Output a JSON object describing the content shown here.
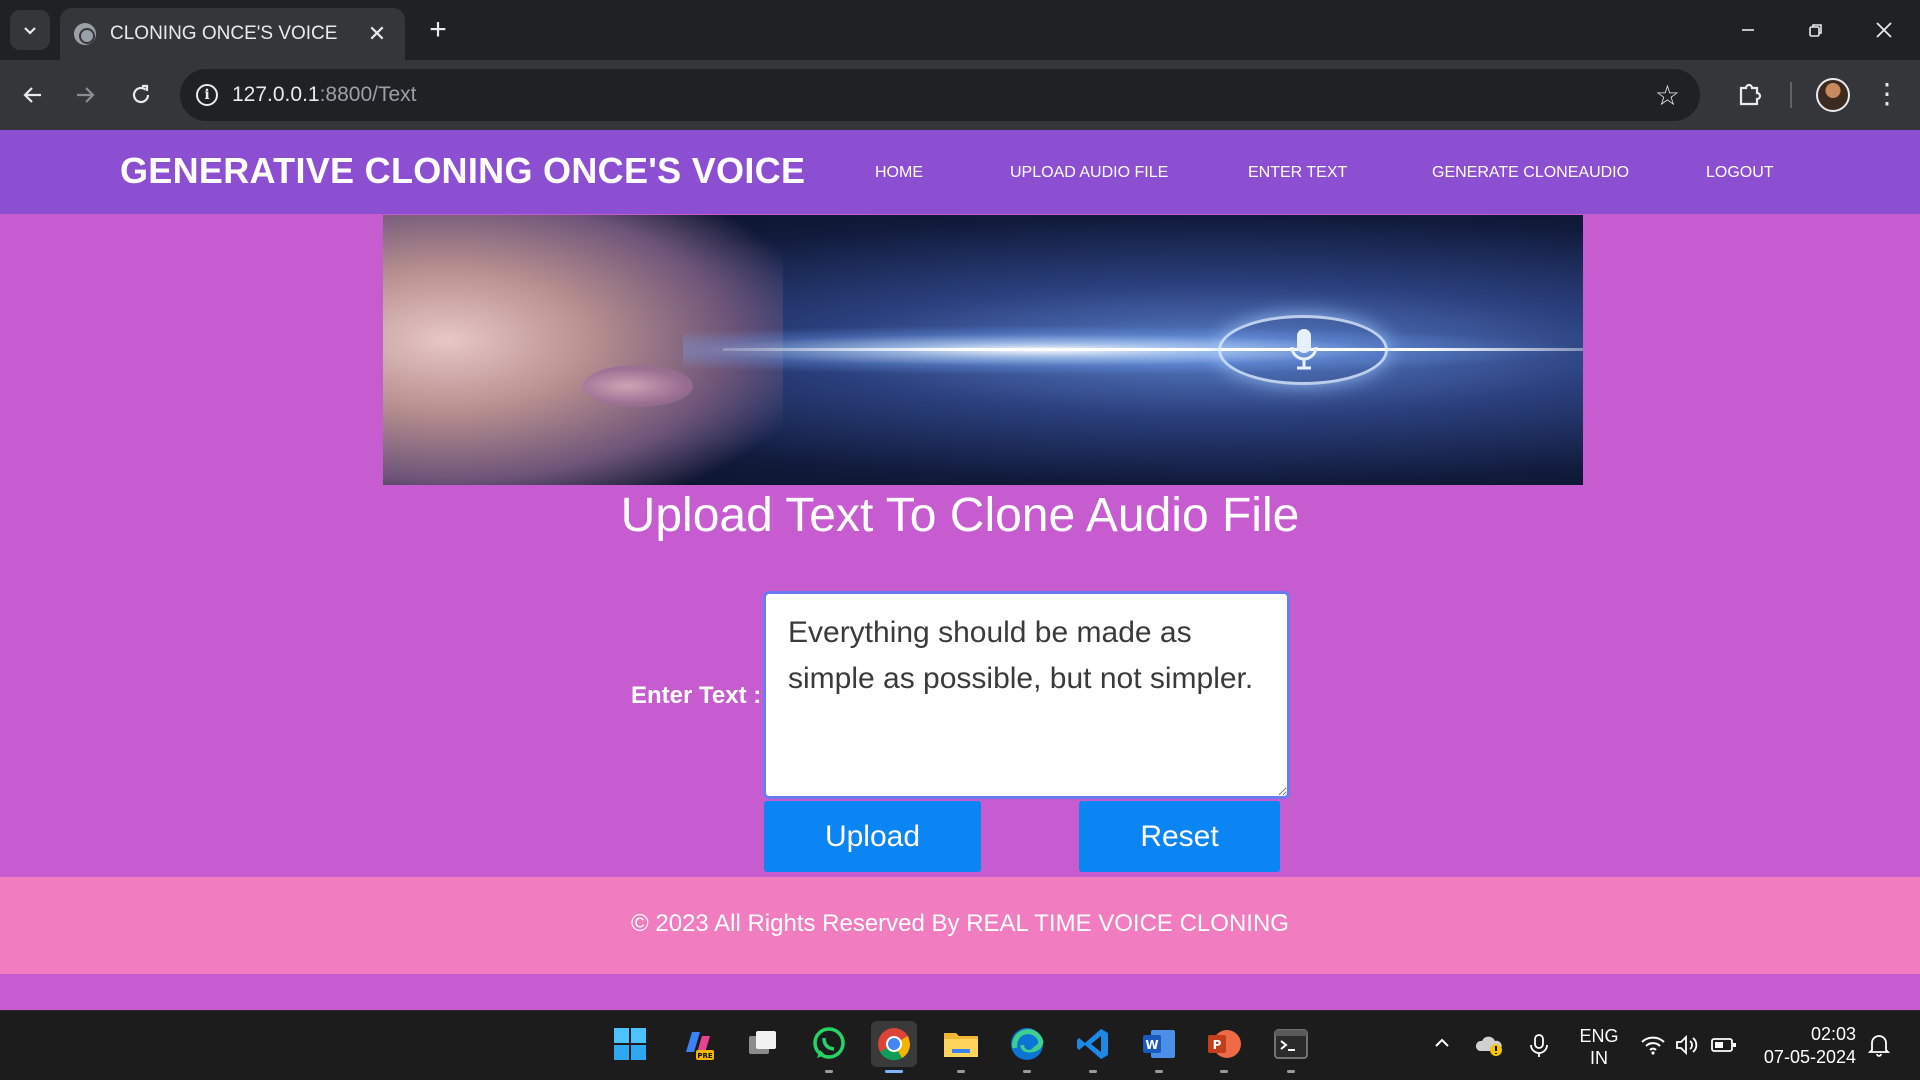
{
  "browser": {
    "tab_title": "CLONING ONCE'S VOICE",
    "url_host": "127.0.0.1",
    "url_path": ":8800/Text"
  },
  "navbar": {
    "brand": "GENERATIVE CLONING ONCE'S VOICE",
    "links": [
      "HOME",
      "UPLOAD AUDIO FILE",
      "ENTER TEXT",
      "GENERATE CLONEAUDIO",
      "LOGOUT"
    ]
  },
  "main": {
    "title": "Upload Text To Clone Audio File",
    "text_label": "Enter Text :",
    "text_value": "Everything should be made as simple as possible, but not simpler.",
    "upload_label": "Upload",
    "reset_label": "Reset"
  },
  "footer": {
    "text": "© 2023 All Rights Reserved By REAL TIME VOICE CLONING"
  },
  "taskbar": {
    "apps": [
      "windows-start",
      "copilot-pre",
      "task-view",
      "whatsapp",
      "chrome",
      "file-explorer",
      "edge",
      "vscode",
      "word",
      "powerpoint",
      "terminal"
    ],
    "lang_line1": "ENG",
    "lang_line2": "IN",
    "time": "02:03",
    "date": "07-05-2024"
  },
  "colors": {
    "navbar": "#8d4fd1",
    "page_bg": "#c65ccf",
    "footer_bg": "#f27cc0",
    "button": "#0b84f4"
  }
}
